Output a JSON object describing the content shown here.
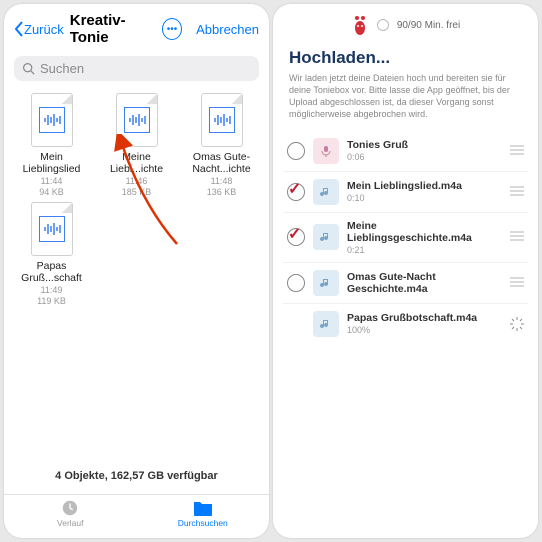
{
  "left": {
    "back": "Zurück",
    "title": "Kreativ-Tonie",
    "cancel": "Abbrechen",
    "search_placeholder": "Suchen",
    "files": [
      {
        "name": "Mein Lieblingslied",
        "time": "11:44",
        "size": "94 KB"
      },
      {
        "name": "Meine Liebl...ichte",
        "time": "11:46",
        "size": "185 KB"
      },
      {
        "name": "Omas Gute-Nacht...ichte",
        "time": "11:48",
        "size": "136 KB"
      },
      {
        "name": "Papas Gruß...schaft",
        "time": "11:49",
        "size": "119 KB"
      }
    ],
    "footer": "4 Objekte, 162,57 GB verfügbar",
    "tab_history": "Verlauf",
    "tab_browse": "Durchsuchen"
  },
  "right": {
    "minutes": "90/90 Min. frei",
    "title": "Hochladen...",
    "desc": "Wir laden jetzt deine Dateien hoch und bereiten sie für deine Toniebox vor. Bitte lasse die App geöffnet, bis der Upload abgeschlossen ist, da dieser Vorgang sonst möglicherweise abgebrochen wird.",
    "items": [
      {
        "name": "Tonies Gruß",
        "time": "0:06",
        "checked": false,
        "kind": "mic"
      },
      {
        "name": "Mein Lieblingslied.m4a",
        "time": "0:10",
        "checked": true,
        "kind": "note"
      },
      {
        "name": "Meine Lieblingsgeschichte.m4a",
        "time": "0:21",
        "checked": true,
        "kind": "note"
      },
      {
        "name": "Omas Gute-Nacht Geschichte.m4a",
        "time": "",
        "checked": false,
        "kind": "note"
      },
      {
        "name": "Papas Grußbotschaft.m4a",
        "time": "100%",
        "checked": null,
        "kind": "note",
        "uploading": true
      }
    ]
  }
}
